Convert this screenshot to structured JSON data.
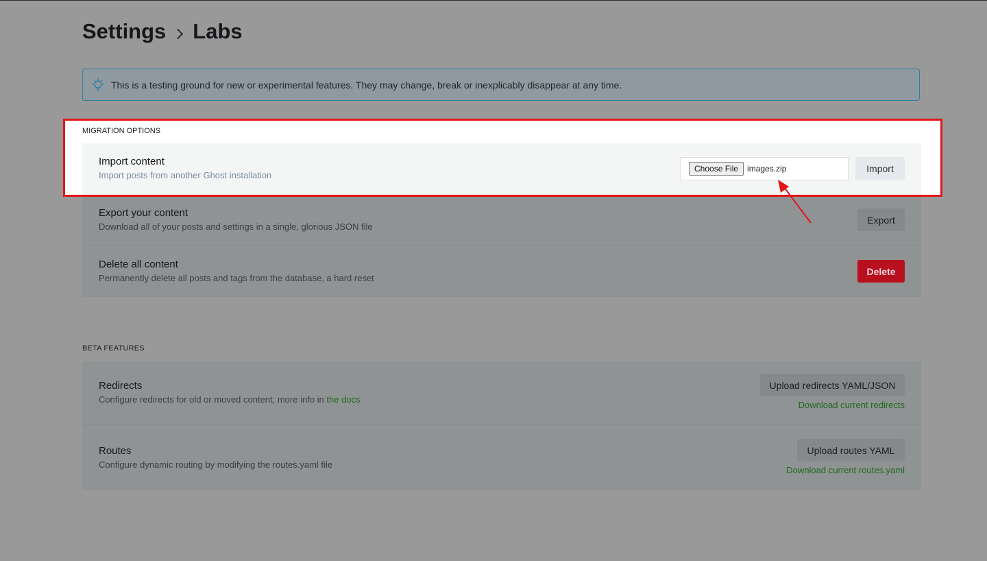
{
  "breadcrumb": {
    "root": "Settings",
    "current": "Labs"
  },
  "notice": {
    "text": "This is a testing ground for new or experimental features. They may change, break or inexplicably disappear at any time.",
    "icon": "lightbulb-icon"
  },
  "migration": {
    "label": "MIGRATION OPTIONS",
    "import": {
      "title": "Import content",
      "desc": "Import posts from another Ghost installation",
      "choose_label": "Choose File",
      "file_name": "images.zip",
      "button": "Import"
    },
    "export": {
      "title": "Export your content",
      "desc": "Download all of your posts and settings in a single, glorious JSON file",
      "button": "Export"
    },
    "delete": {
      "title": "Delete all content",
      "desc": "Permanently delete all posts and tags from the database, a hard reset",
      "button": "Delete"
    }
  },
  "beta": {
    "label": "BETA FEATURES",
    "redirects": {
      "title": "Redirects",
      "desc": "Configure redirects for old or moved content, more info in ",
      "docs_link": "the docs",
      "upload": "Upload redirects YAML/JSON",
      "download": "Download current redirects"
    },
    "routes": {
      "title": "Routes",
      "desc": "Configure dynamic routing by modifying the routes.yaml file",
      "upload": "Upload routes YAML",
      "download": "Download current routes.yaml"
    }
  },
  "colors": {
    "highlight_border": "#e2161b",
    "link_green": "#30cf43",
    "delete_red": "#e2161b",
    "notice_border": "#2f7fa3"
  }
}
